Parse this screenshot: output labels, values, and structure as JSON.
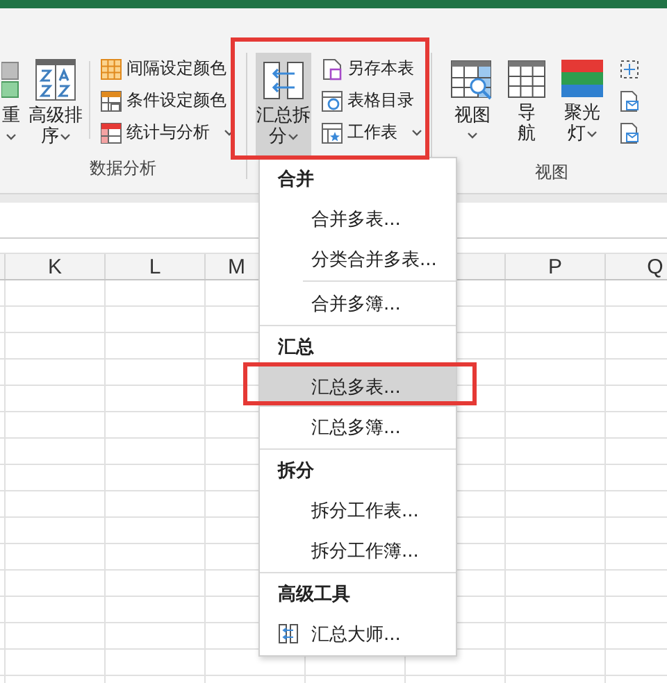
{
  "ribbon": {
    "groups": [
      {
        "label": "数据分析",
        "large": [
          {
            "label": "重",
            "caret": true,
            "pressed": false
          },
          {
            "label": "高级排序",
            "caret": true,
            "pressed": false
          }
        ],
        "small": [
          {
            "kind": "labeled",
            "label": "间隔设定颜色",
            "caret": false
          },
          {
            "kind": "labeled",
            "label": "条件设定颜色",
            "caret": false
          },
          {
            "kind": "labeled",
            "label": "统计与分析",
            "caret": true
          }
        ]
      },
      {
        "large": [
          {
            "label": "汇总拆分",
            "caret": true,
            "pressed": true
          }
        ],
        "small": [
          {
            "kind": "labeled",
            "label": "另存本表",
            "caret": false
          },
          {
            "kind": "labeled",
            "label": "表格目录",
            "caret": false
          },
          {
            "kind": "labeled",
            "label": "工作表",
            "caret": true
          }
        ]
      },
      {
        "label": "视图",
        "large": [
          {
            "label": "视图",
            "caret": true,
            "pressed": false
          },
          {
            "label": "导航",
            "caret": false,
            "pressed": false
          },
          {
            "label": "聚光灯",
            "caret": true,
            "pressed": false
          }
        ],
        "small": [
          {
            "kind": "icon"
          },
          {
            "kind": "icon"
          },
          {
            "kind": "icon"
          }
        ]
      }
    ]
  },
  "menu": {
    "sections": [
      {
        "title": "合并",
        "items": [
          {
            "label": "合并多表...",
            "selected": false,
            "divider_above": false
          },
          {
            "label": "分类合并多表...",
            "selected": false,
            "divider_above": false
          },
          {
            "label": "合并多簿...",
            "selected": false,
            "divider_above": true
          }
        ]
      },
      {
        "title": "汇总",
        "items": [
          {
            "label": "汇总多表...",
            "selected": true,
            "divider_above": false
          },
          {
            "label": "汇总多簿...",
            "selected": false,
            "divider_above": false
          }
        ]
      },
      {
        "title": "拆分",
        "items": [
          {
            "label": "拆分工作表...",
            "selected": false,
            "divider_above": false
          },
          {
            "label": "拆分工作簿...",
            "selected": false,
            "divider_above": false
          }
        ]
      },
      {
        "title": "高级工具",
        "items": [
          {
            "label": "汇总大师...",
            "selected": false,
            "divider_above": false,
            "kind": "with-icon"
          }
        ]
      }
    ]
  },
  "sheet": {
    "columns": [
      {
        "label": "K"
      },
      {
        "label": "L"
      },
      {
        "label": "M"
      },
      {
        "label": "P"
      },
      {
        "label": "Q"
      }
    ]
  }
}
